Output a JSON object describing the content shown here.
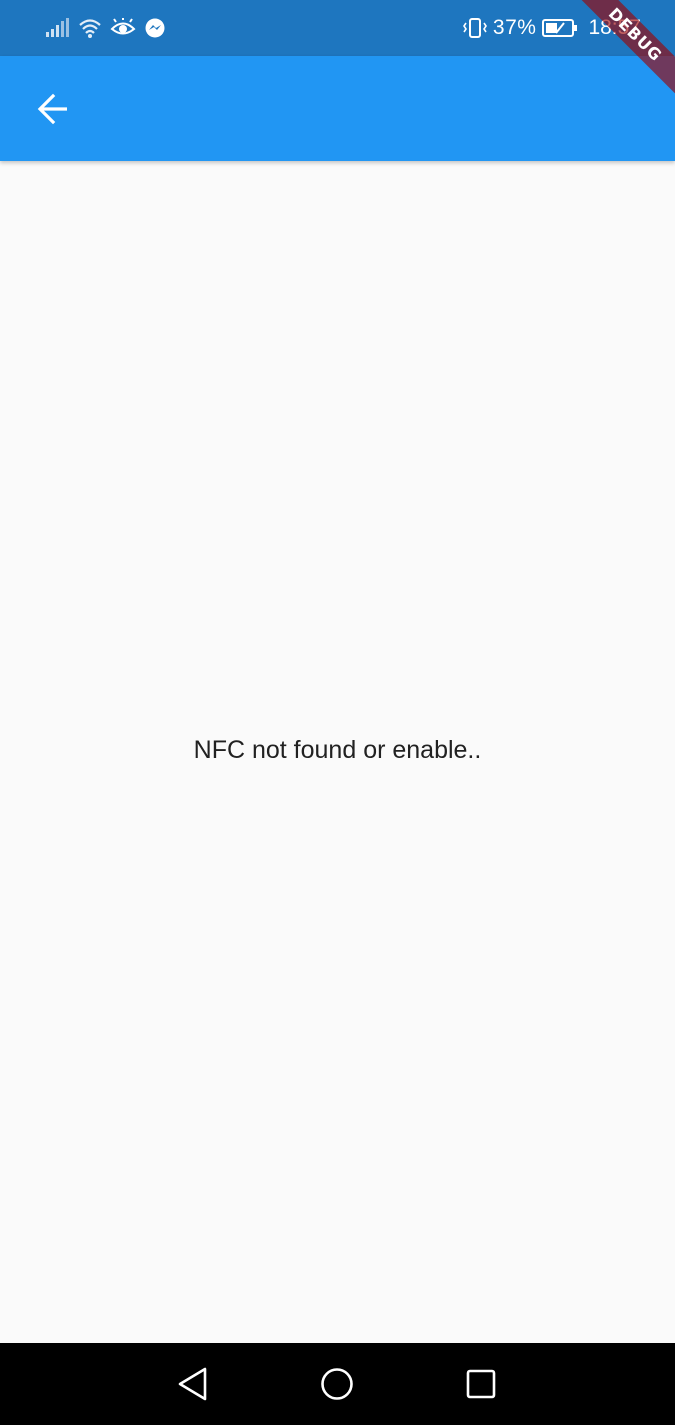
{
  "status_bar": {
    "battery_percent": "37%",
    "time": "18:57",
    "icons_left": [
      "signal-icon",
      "wifi-icon",
      "eye-icon",
      "messenger-icon"
    ],
    "icons_right": [
      "vibrate-icon",
      "battery-icon"
    ]
  },
  "app_bar": {
    "back_icon": "arrow-back-icon",
    "background": "#2196f3"
  },
  "body": {
    "message": "NFC not found or enable.."
  },
  "nav_bar": {
    "buttons": [
      "back-triangle-icon",
      "home-circle-icon",
      "recents-square-icon"
    ]
  },
  "debug_banner": {
    "label": "DEBUG"
  },
  "colors": {
    "status_bar": "#1e76bf",
    "app_bar": "#2196f3",
    "background": "#fafafa",
    "text": "#212121",
    "nav_bar": "#000000"
  }
}
